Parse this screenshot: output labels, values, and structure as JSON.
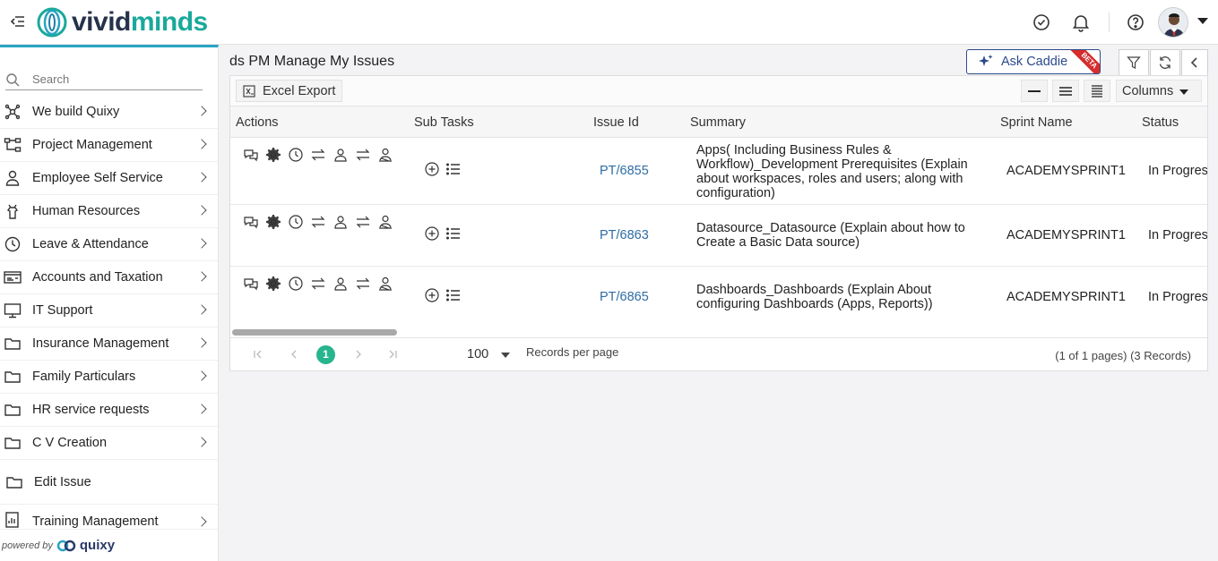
{
  "header": {
    "logo": {
      "part1": "vivid",
      "part2": "minds"
    },
    "icons": [
      "menu-collapse-icon",
      "check-circle-icon",
      "bell-icon",
      "help-icon"
    ]
  },
  "sidebar": {
    "search_placeholder": "Search",
    "items": [
      {
        "label": "We build Quixy",
        "icon": "network-icon",
        "chevron": true
      },
      {
        "label": "Project Management",
        "icon": "hierarchy-icon",
        "chevron": true
      },
      {
        "label": "Employee Self Service",
        "icon": "person-icon",
        "chevron": true
      },
      {
        "label": "Human Resources",
        "icon": "hanger-icon",
        "chevron": true
      },
      {
        "label": "Leave & Attendance",
        "icon": "clock-icon",
        "chevron": true
      },
      {
        "label": "Accounts and Taxation",
        "icon": "card-icon",
        "chevron": true
      },
      {
        "label": "IT Support",
        "icon": "monitor-icon",
        "chevron": true
      },
      {
        "label": "Insurance Management",
        "icon": "folder-icon",
        "chevron": true
      },
      {
        "label": "Family Particulars",
        "icon": "folder-icon",
        "chevron": true
      },
      {
        "label": "HR service requests",
        "icon": "folder-icon",
        "chevron": true
      },
      {
        "label": "C V Creation",
        "icon": "folder-icon",
        "chevron": true
      },
      {
        "label": "Edit Issue",
        "icon": "folder-icon",
        "chevron": false
      },
      {
        "label": "Training Management",
        "icon": "report-icon",
        "chevron": true
      }
    ],
    "powered_by": "powered by",
    "powered_brand": "quixy"
  },
  "main": {
    "title": "ds PM Manage My Issues",
    "ask_caddie": "Ask Caddie",
    "beta": "BETA",
    "excel_export": "Excel Export",
    "columns_label": "Columns",
    "table": {
      "headers": [
        "Actions",
        "Sub Tasks",
        "Issue Id",
        "Summary",
        "Sprint Name",
        "Status"
      ],
      "rows": [
        {
          "issue_id": "PT/6855",
          "summary": "Apps( Including Business Rules & Workflow)_Development Prerequisites (Explain about workspaces, roles and users; along with configuration)",
          "sprint": "ACADEMYSPRINT1",
          "status": "In Progres"
        },
        {
          "issue_id": "PT/6863",
          "summary": "Datasource_Datasource (Explain about how to Create a Basic Data source)",
          "sprint": "ACADEMYSPRINT1",
          "status": "In Progres"
        },
        {
          "issue_id": "PT/6865",
          "summary": "Dashboards_Dashboards (Explain About configuring Dashboards (Apps, Reports))",
          "sprint": "ACADEMYSPRINT1",
          "status": "In Progres"
        }
      ]
    },
    "pager": {
      "current_page": "1",
      "page_size": "100",
      "records_per_page": "Records per page",
      "info": "(1 of 1 pages) (3 Records)"
    }
  },
  "colors": {
    "accent": "#1aa99b",
    "brand_dark": "#26324a",
    "link": "#2e6da4",
    "pager_active": "#27b58d",
    "beta": "#d62c2c"
  }
}
